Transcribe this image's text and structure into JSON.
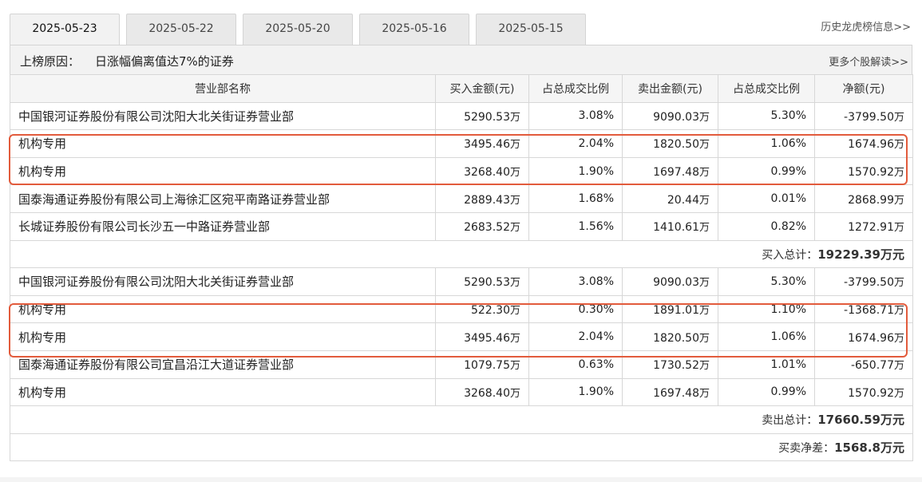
{
  "tabs": [
    {
      "label": "2025-05-23",
      "active": true
    },
    {
      "label": "2025-05-22",
      "active": false
    },
    {
      "label": "2025-05-20",
      "active": false
    },
    {
      "label": "2025-05-16",
      "active": false
    },
    {
      "label": "2025-05-15",
      "active": false
    }
  ],
  "history_link": "历史龙虎榜信息>>",
  "reason": {
    "label": "上榜原因：",
    "text": "日涨幅偏离值达7%的证券",
    "more_link": "更多个股解读>>"
  },
  "columns": [
    "营业部名称",
    "买入金额(元)",
    "占总成交比例",
    "卖出金额(元)",
    "占总成交比例",
    "净额(元)"
  ],
  "unit": "万",
  "buy_rows": [
    {
      "name": "中国银河证券股份有限公司沈阳大北关街证券营业部",
      "buy": "5290.53",
      "buy_pct": "3.08%",
      "sell": "9090.03",
      "sell_pct": "5.30%",
      "net": "-3799.50"
    },
    {
      "name": "机构专用",
      "buy": "3495.46",
      "buy_pct": "2.04%",
      "sell": "1820.50",
      "sell_pct": "1.06%",
      "net": "1674.96"
    },
    {
      "name": "机构专用",
      "buy": "3268.40",
      "buy_pct": "1.90%",
      "sell": "1697.48",
      "sell_pct": "0.99%",
      "net": "1570.92"
    },
    {
      "name": "国泰海通证券股份有限公司上海徐汇区宛平南路证券营业部",
      "buy": "2889.43",
      "buy_pct": "1.68%",
      "sell": "20.44",
      "sell_pct": "0.01%",
      "net": "2868.99"
    },
    {
      "name": "长城证券股份有限公司长沙五一中路证券营业部",
      "buy": "2683.52",
      "buy_pct": "1.56%",
      "sell": "1410.61",
      "sell_pct": "0.82%",
      "net": "1272.91"
    }
  ],
  "buy_total": {
    "label": "买入总计：",
    "value": "19229.39",
    "unit": "万元"
  },
  "sell_rows": [
    {
      "name": "中国银河证券股份有限公司沈阳大北关街证券营业部",
      "buy": "5290.53",
      "buy_pct": "3.08%",
      "sell": "9090.03",
      "sell_pct": "5.30%",
      "net": "-3799.50"
    },
    {
      "name": "机构专用",
      "buy": "522.30",
      "buy_pct": "0.30%",
      "sell": "1891.01",
      "sell_pct": "1.10%",
      "net": "-1368.71"
    },
    {
      "name": "机构专用",
      "buy": "3495.46",
      "buy_pct": "2.04%",
      "sell": "1820.50",
      "sell_pct": "1.06%",
      "net": "1674.96"
    },
    {
      "name": "国泰海通证券股份有限公司宜昌沿江大道证券营业部",
      "buy": "1079.75",
      "buy_pct": "0.63%",
      "sell": "1730.52",
      "sell_pct": "1.01%",
      "net": "-650.77"
    },
    {
      "name": "机构专用",
      "buy": "3268.40",
      "buy_pct": "1.90%",
      "sell": "1697.48",
      "sell_pct": "0.99%",
      "net": "1570.92"
    }
  ],
  "sell_total": {
    "label": "卖出总计：",
    "value": "17660.59",
    "unit": "万元"
  },
  "net_total": {
    "label": "买卖净差：",
    "value": "1568.8",
    "unit": "万元"
  },
  "colors": {
    "highlight": "#e25b3c",
    "tab_bg": "#e9e9e9",
    "header_bg": "#f2f2f2",
    "border": "#d7d7d7"
  }
}
